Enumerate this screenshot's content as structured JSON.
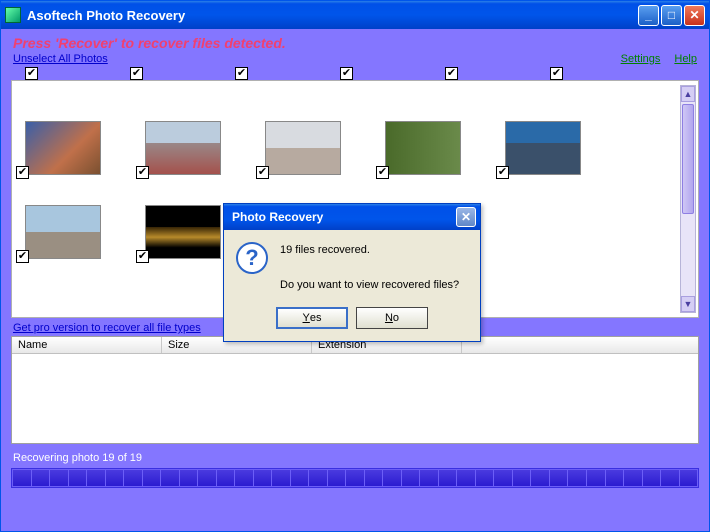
{
  "window": {
    "title": "Asoftech Photo Recovery"
  },
  "instruction": "Press 'Recover' to recover files detected.",
  "links": {
    "unselect": "Unselect All Photos",
    "settings": "Settings",
    "help": "Help",
    "pro": "Get pro version to recover all file types"
  },
  "table": {
    "headers": {
      "name": "Name",
      "size": "Size",
      "extension": "Extension"
    }
  },
  "status": "Recovering photo 19 of 19",
  "dialog": {
    "title": "Photo Recovery",
    "line1": "19 files recovered.",
    "line2": "Do you want to view recovered files?",
    "yes": "Yes",
    "no": "No"
  }
}
